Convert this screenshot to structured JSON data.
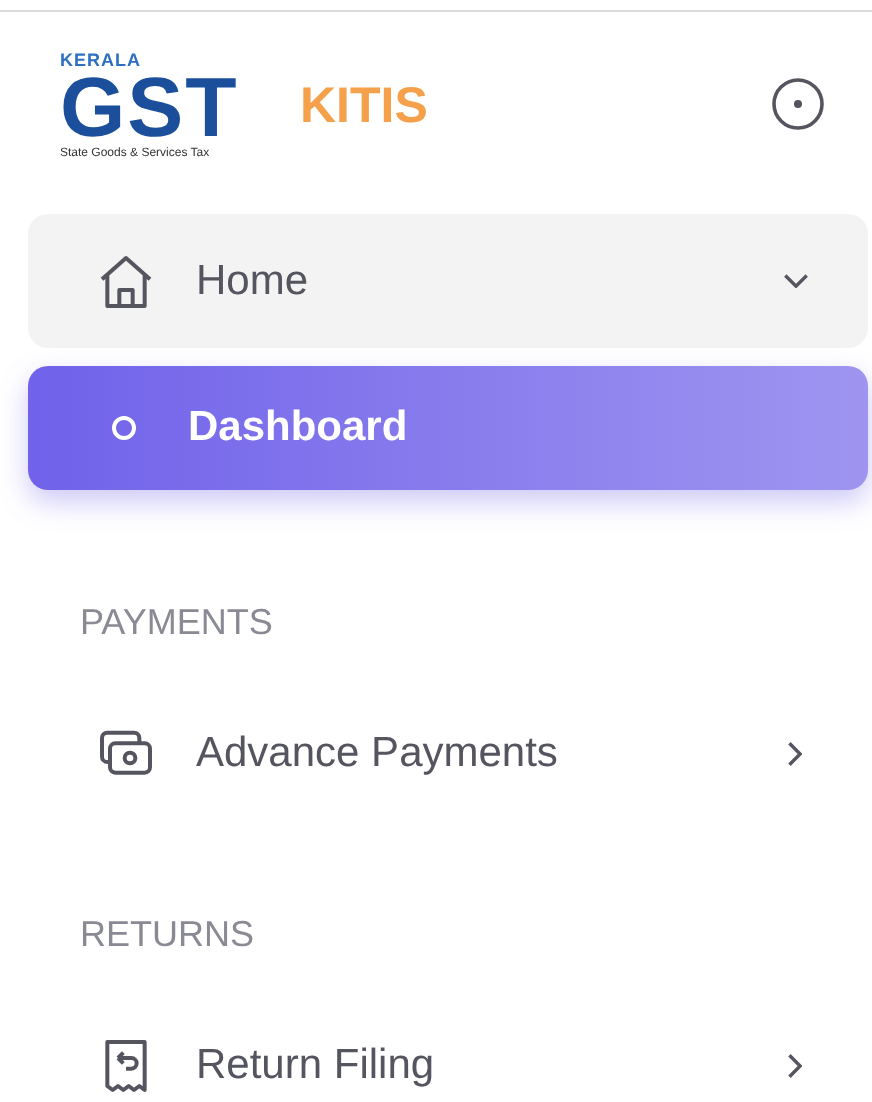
{
  "header": {
    "logo": {
      "top": "KERALA",
      "main": "GST",
      "tagline": "State Goods & Services Tax"
    },
    "app_name": "KITIS"
  },
  "nav": [
    {
      "kind": "group",
      "label": "Home",
      "expanded": true,
      "selected": false
    },
    {
      "kind": "subitem",
      "label": "Dashboard",
      "selected": true
    },
    {
      "kind": "heading",
      "label": "PAYMENTS"
    },
    {
      "kind": "item",
      "label": "Advance Payments",
      "expanded": false,
      "selected": false
    },
    {
      "kind": "heading",
      "label": "RETURNS"
    },
    {
      "kind": "item",
      "label": "Return Filing",
      "expanded": false,
      "selected": false
    }
  ]
}
